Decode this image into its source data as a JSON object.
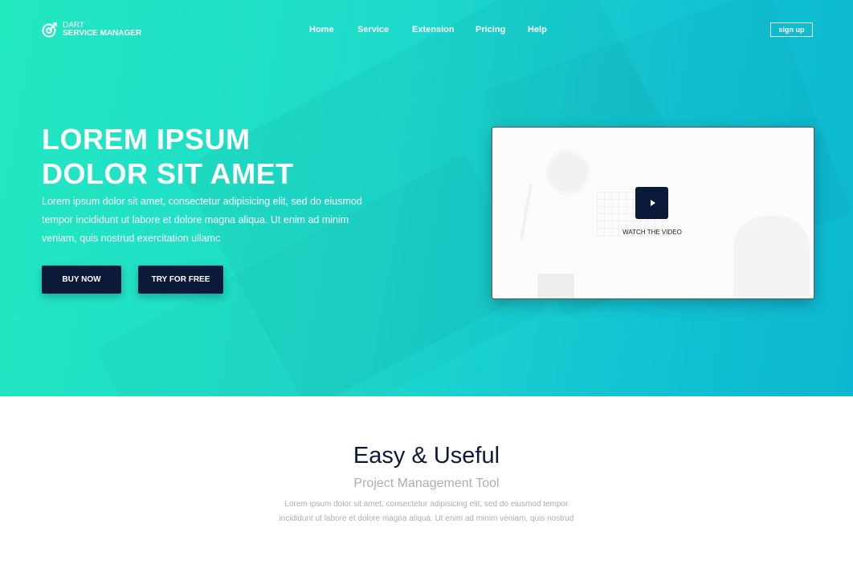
{
  "logo": {
    "line1": "DART",
    "line2": "SERVICE MANAGER",
    "icon": "target-icon"
  },
  "nav": {
    "items": [
      "Home",
      "Service",
      "Extension",
      "Pricing",
      "Help"
    ]
  },
  "header": {
    "signup_label": "sign up"
  },
  "hero": {
    "title_line1": "LOREM IPSUM",
    "title_line2": "DOLOR SIT AMET",
    "description": "Lorem ipsum dolor sit amet, consectetur adipisicing elit, sed do eiusmod tempor incididunt ut labore et dolore magna aliqua. Ut enim ad minim veniam, quis nostrud exercitation ullamc",
    "buy_label": "BUY NOW",
    "try_label": "TRY FOR FREE"
  },
  "video": {
    "watch_label": "WATCH THE VIDEO",
    "icon": "play-icon"
  },
  "features": {
    "title": "Easy & Useful",
    "subtitle": "Project Management Tool",
    "description": "Lorem ipsum dolor sit amet, consectetur adipisicing elit, sed do eiusmod tempor incididunt ut labore et dolore magna aliqua. Ut enim ad minim veniam, quis nostrud"
  },
  "colors": {
    "gradient_start": "#22e8c0",
    "gradient_end": "#0cb6d0",
    "dark_navy": "#0c1a3a",
    "muted_text": "#a9aeb8"
  }
}
